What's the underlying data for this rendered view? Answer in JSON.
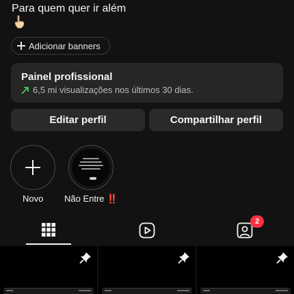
{
  "profile": {
    "bio_text": "Para quem quer ir além",
    "bio_emoji_icon": "pointing-down-hand-icon"
  },
  "banners": {
    "label": "Adicionar banners",
    "icon": "plus-icon"
  },
  "professional_panel": {
    "title": "Painel profissional",
    "subtitle": "6,5 mi visualizações nos últimos 30 dias.",
    "trend_icon": "trending-up-icon",
    "trend_color": "#4cd964"
  },
  "actions": {
    "edit_label": "Editar perfil",
    "share_label": "Compartilhar perfil"
  },
  "highlights": [
    {
      "label": "Novo",
      "icon": "plus-icon"
    },
    {
      "label": "Não Entre ‼️",
      "icon": "story-thumbnail"
    }
  ],
  "tabs": {
    "items": [
      {
        "name": "posts-grid",
        "icon": "grid-icon",
        "active": true
      },
      {
        "name": "reels",
        "icon": "reels-play-icon",
        "active": false
      },
      {
        "name": "tagged",
        "icon": "tagged-person-icon",
        "active": false
      }
    ],
    "tagged_badge": "2",
    "badge_color": "#ff3040"
  },
  "posts": [
    {
      "pinned": true,
      "icon": "pin-icon"
    },
    {
      "pinned": true,
      "icon": "pin-icon"
    },
    {
      "pinned": true,
      "icon": "pin-icon"
    }
  ]
}
